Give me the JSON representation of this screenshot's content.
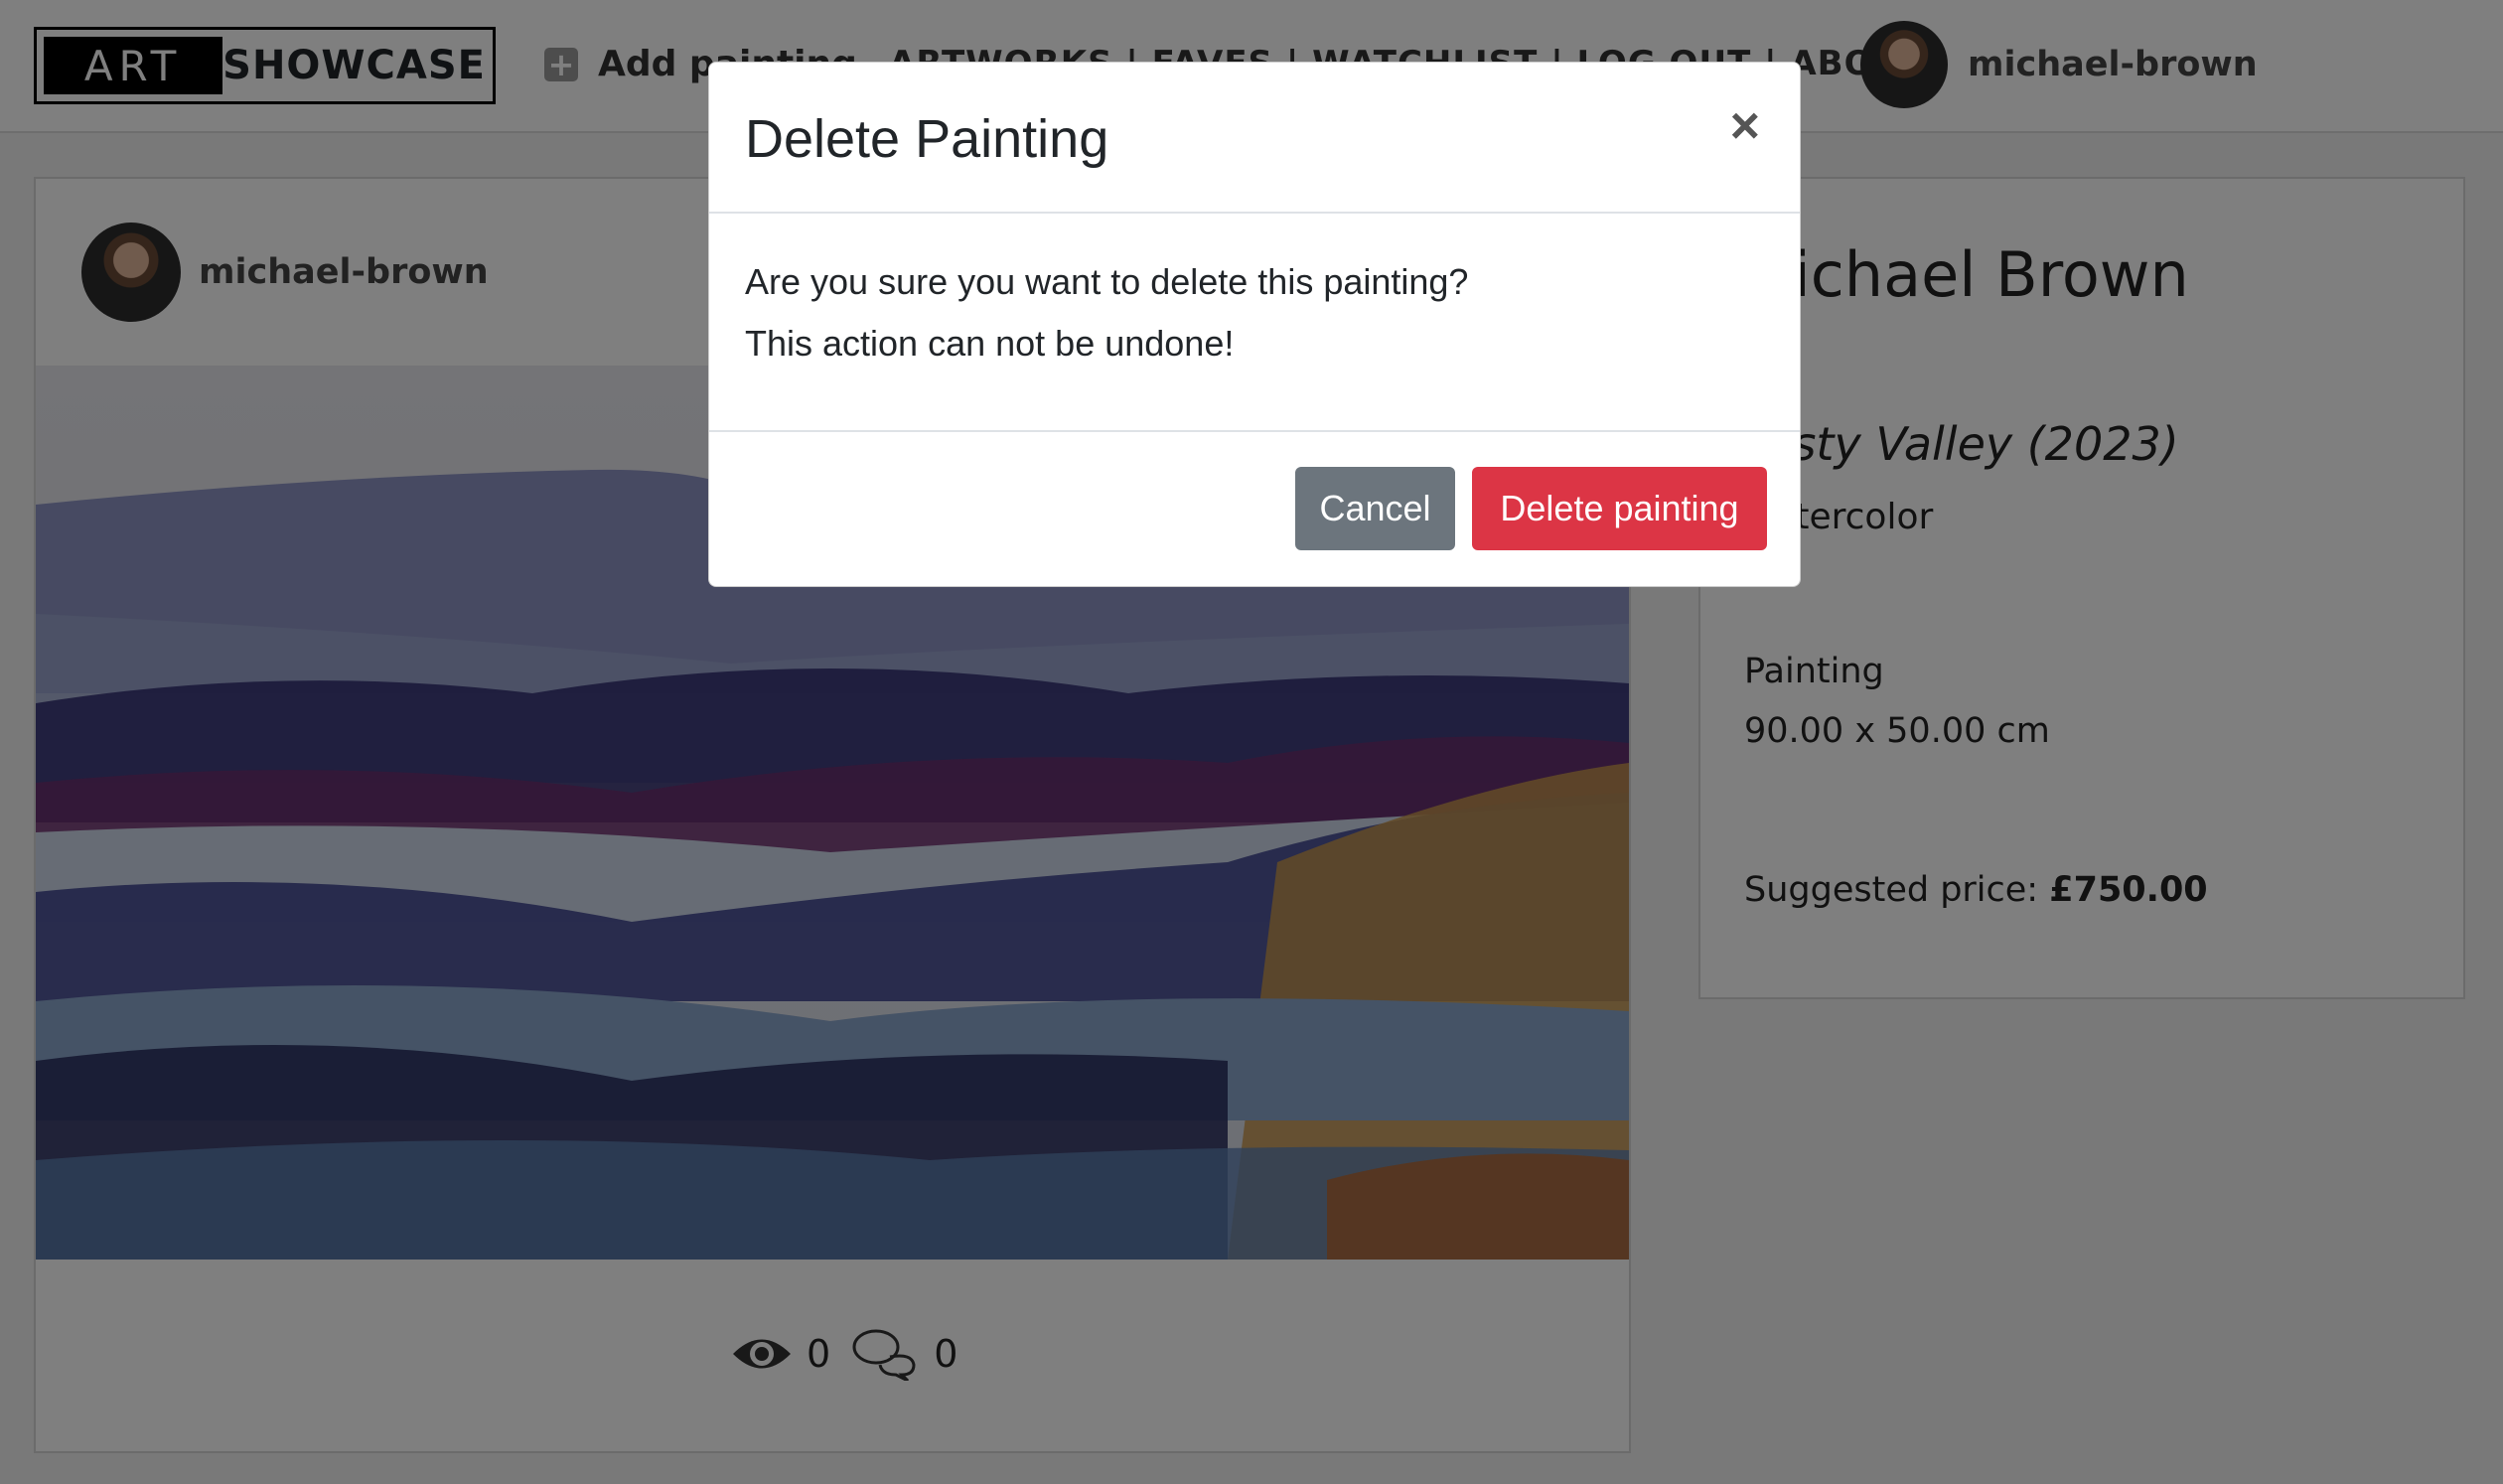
{
  "navbar": {
    "logo_left": "ART",
    "logo_right": "SHOWCASE",
    "add_painting": "Add painting",
    "links": "ARTWORKS | FAVES | WATCHLIST | LOG OUT | ABOUT",
    "username": "michael-brown"
  },
  "post": {
    "username": "michael-brown",
    "views": "0",
    "comments": "0"
  },
  "details": {
    "artist": "Michael Brown",
    "title": "Misty Valley (2023)",
    "medium": "Watercolor",
    "category": "Painting",
    "size": "90.00 x 50.00 cm",
    "price_label": "Suggested price:",
    "price_value": "£750.00"
  },
  "modal": {
    "title": "Delete Painting",
    "close": "×",
    "line1": "Are you sure you want to delete this painting?",
    "line2": "This action can not be undone!",
    "cancel": "Cancel",
    "confirm": "Delete painting"
  },
  "colors": {
    "danger": "#dc3545",
    "secondary": "#6c757d"
  }
}
